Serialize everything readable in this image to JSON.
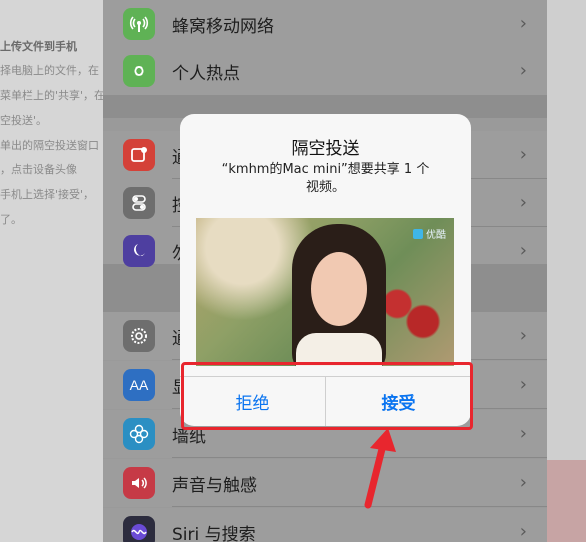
{
  "background_article": {
    "lines": [
      "上传文件到手机",
      "择电脑上的文件，在",
      "菜单栏上的'共享'，在",
      "空投送'。",
      "单出的隔空投送窗口",
      "，点击设备头像",
      "手机上选择'接受'，",
      "了。"
    ]
  },
  "settings": {
    "rows": [
      {
        "label": "蜂窝移动网络",
        "icon": "antenna-icon",
        "color": "#5fb255"
      },
      {
        "label": "个人热点",
        "icon": "hotspot-icon",
        "color": "#5fb255"
      },
      {
        "label": "通",
        "icon": "notification-icon",
        "color": "#d44138"
      },
      {
        "label": "控",
        "icon": "control-center-icon",
        "color": "#6e6e6e"
      },
      {
        "label": "勿",
        "icon": "moon-icon",
        "color": "#4e3fa0"
      },
      {
        "label": "通",
        "icon": "gear-icon",
        "color": "#6e6e6e"
      },
      {
        "label": "显",
        "icon": "display-icon",
        "color": "#2e6fc2"
      },
      {
        "label": "墙纸",
        "icon": "wallpaper-icon",
        "color": "#2b8fc3"
      },
      {
        "label": "声音与触感",
        "icon": "sound-icon",
        "color": "#c63a46"
      },
      {
        "label": "Siri 与搜索",
        "icon": "siri-icon",
        "color": "#2c2c3e"
      }
    ],
    "chevron": "›"
  },
  "dialog": {
    "title": "隔空投送",
    "message": "“kmhm的Mac mini”想要共享 1 个视频。",
    "decline": "拒绝",
    "accept": "接受",
    "accent": "#0a74f0"
  },
  "annotation": {
    "color": "#e8262e"
  }
}
